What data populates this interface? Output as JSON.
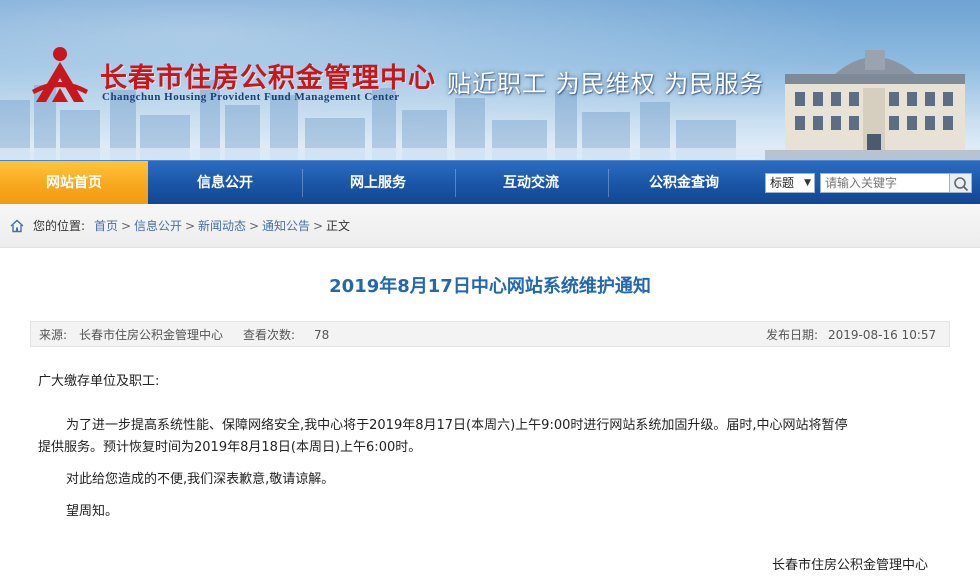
{
  "header": {
    "title": "长春市住房公积金管理中心",
    "subtitle": "Changchun Housing Provident Fund Management Center",
    "slogan": "贴近职工  为民维权  为民服务",
    "brand_red": "#c8161d",
    "logo_icon": "provident-fund-emblem"
  },
  "nav": {
    "items": [
      {
        "label": "网站首页",
        "active": true
      },
      {
        "label": "信息公开",
        "active": false
      },
      {
        "label": "网上服务",
        "active": false
      },
      {
        "label": "互动交流",
        "active": false
      },
      {
        "label": "公积金查询",
        "active": false
      }
    ],
    "search_scope": "标题",
    "search_placeholder": "请输入关键字",
    "search_icon": "magnifier-icon",
    "active_color": "#f7a51c",
    "bar_color": "#1a55a6"
  },
  "breadcrumb": {
    "label": "您的位置:",
    "links": [
      "首页",
      "信息公开",
      "新闻动态",
      "通知公告"
    ],
    "separator": ">",
    "current": "正文",
    "icon": "home-icon"
  },
  "article": {
    "title": "2019年8月17日中心网站系统维护通知",
    "title_color": "#2367ad",
    "meta": {
      "source_label": "来源:",
      "source": "长春市住房公积金管理中心",
      "views_label": "查看次数:",
      "views": "78",
      "date_label": "发布日期:",
      "date": "2019-08-16 10:57"
    },
    "salutation": "广大缴存单位及职工:",
    "paragraph1_line1": "为了进一步提高系统性能、保障网络安全,我中心将于2019年8月17日(本周六)上午9:00时进行网站系统加固升级。届时,中心网站将暂停",
    "paragraph1_line2": "提供服务。预计恢复时间为2019年8月18日(本周日)上午6:00时。",
    "paragraph2": "对此给您造成的不便,我们深表歉意,敬请谅解。",
    "paragraph3": "望周知。",
    "signature": "长春市住房公积金管理中心"
  }
}
